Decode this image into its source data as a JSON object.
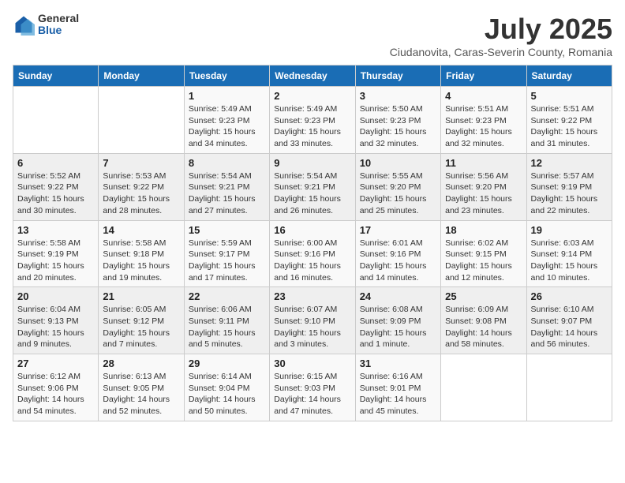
{
  "header": {
    "logo": {
      "general": "General",
      "blue": "Blue"
    },
    "month": "July 2025",
    "location": "Ciudanovita, Caras-Severin County, Romania"
  },
  "weekdays": [
    "Sunday",
    "Monday",
    "Tuesday",
    "Wednesday",
    "Thursday",
    "Friday",
    "Saturday"
  ],
  "weeks": [
    [
      {
        "day": "",
        "sunrise": "",
        "sunset": "",
        "daylight": ""
      },
      {
        "day": "",
        "sunrise": "",
        "sunset": "",
        "daylight": ""
      },
      {
        "day": "1",
        "sunrise": "Sunrise: 5:49 AM",
        "sunset": "Sunset: 9:23 PM",
        "daylight": "Daylight: 15 hours and 34 minutes."
      },
      {
        "day": "2",
        "sunrise": "Sunrise: 5:49 AM",
        "sunset": "Sunset: 9:23 PM",
        "daylight": "Daylight: 15 hours and 33 minutes."
      },
      {
        "day": "3",
        "sunrise": "Sunrise: 5:50 AM",
        "sunset": "Sunset: 9:23 PM",
        "daylight": "Daylight: 15 hours and 32 minutes."
      },
      {
        "day": "4",
        "sunrise": "Sunrise: 5:51 AM",
        "sunset": "Sunset: 9:23 PM",
        "daylight": "Daylight: 15 hours and 32 minutes."
      },
      {
        "day": "5",
        "sunrise": "Sunrise: 5:51 AM",
        "sunset": "Sunset: 9:22 PM",
        "daylight": "Daylight: 15 hours and 31 minutes."
      }
    ],
    [
      {
        "day": "6",
        "sunrise": "Sunrise: 5:52 AM",
        "sunset": "Sunset: 9:22 PM",
        "daylight": "Daylight: 15 hours and 30 minutes."
      },
      {
        "day": "7",
        "sunrise": "Sunrise: 5:53 AM",
        "sunset": "Sunset: 9:22 PM",
        "daylight": "Daylight: 15 hours and 28 minutes."
      },
      {
        "day": "8",
        "sunrise": "Sunrise: 5:54 AM",
        "sunset": "Sunset: 9:21 PM",
        "daylight": "Daylight: 15 hours and 27 minutes."
      },
      {
        "day": "9",
        "sunrise": "Sunrise: 5:54 AM",
        "sunset": "Sunset: 9:21 PM",
        "daylight": "Daylight: 15 hours and 26 minutes."
      },
      {
        "day": "10",
        "sunrise": "Sunrise: 5:55 AM",
        "sunset": "Sunset: 9:20 PM",
        "daylight": "Daylight: 15 hours and 25 minutes."
      },
      {
        "day": "11",
        "sunrise": "Sunrise: 5:56 AM",
        "sunset": "Sunset: 9:20 PM",
        "daylight": "Daylight: 15 hours and 23 minutes."
      },
      {
        "day": "12",
        "sunrise": "Sunrise: 5:57 AM",
        "sunset": "Sunset: 9:19 PM",
        "daylight": "Daylight: 15 hours and 22 minutes."
      }
    ],
    [
      {
        "day": "13",
        "sunrise": "Sunrise: 5:58 AM",
        "sunset": "Sunset: 9:19 PM",
        "daylight": "Daylight: 15 hours and 20 minutes."
      },
      {
        "day": "14",
        "sunrise": "Sunrise: 5:58 AM",
        "sunset": "Sunset: 9:18 PM",
        "daylight": "Daylight: 15 hours and 19 minutes."
      },
      {
        "day": "15",
        "sunrise": "Sunrise: 5:59 AM",
        "sunset": "Sunset: 9:17 PM",
        "daylight": "Daylight: 15 hours and 17 minutes."
      },
      {
        "day": "16",
        "sunrise": "Sunrise: 6:00 AM",
        "sunset": "Sunset: 9:16 PM",
        "daylight": "Daylight: 15 hours and 16 minutes."
      },
      {
        "day": "17",
        "sunrise": "Sunrise: 6:01 AM",
        "sunset": "Sunset: 9:16 PM",
        "daylight": "Daylight: 15 hours and 14 minutes."
      },
      {
        "day": "18",
        "sunrise": "Sunrise: 6:02 AM",
        "sunset": "Sunset: 9:15 PM",
        "daylight": "Daylight: 15 hours and 12 minutes."
      },
      {
        "day": "19",
        "sunrise": "Sunrise: 6:03 AM",
        "sunset": "Sunset: 9:14 PM",
        "daylight": "Daylight: 15 hours and 10 minutes."
      }
    ],
    [
      {
        "day": "20",
        "sunrise": "Sunrise: 6:04 AM",
        "sunset": "Sunset: 9:13 PM",
        "daylight": "Daylight: 15 hours and 9 minutes."
      },
      {
        "day": "21",
        "sunrise": "Sunrise: 6:05 AM",
        "sunset": "Sunset: 9:12 PM",
        "daylight": "Daylight: 15 hours and 7 minutes."
      },
      {
        "day": "22",
        "sunrise": "Sunrise: 6:06 AM",
        "sunset": "Sunset: 9:11 PM",
        "daylight": "Daylight: 15 hours and 5 minutes."
      },
      {
        "day": "23",
        "sunrise": "Sunrise: 6:07 AM",
        "sunset": "Sunset: 9:10 PM",
        "daylight": "Daylight: 15 hours and 3 minutes."
      },
      {
        "day": "24",
        "sunrise": "Sunrise: 6:08 AM",
        "sunset": "Sunset: 9:09 PM",
        "daylight": "Daylight: 15 hours and 1 minute."
      },
      {
        "day": "25",
        "sunrise": "Sunrise: 6:09 AM",
        "sunset": "Sunset: 9:08 PM",
        "daylight": "Daylight: 14 hours and 58 minutes."
      },
      {
        "day": "26",
        "sunrise": "Sunrise: 6:10 AM",
        "sunset": "Sunset: 9:07 PM",
        "daylight": "Daylight: 14 hours and 56 minutes."
      }
    ],
    [
      {
        "day": "27",
        "sunrise": "Sunrise: 6:12 AM",
        "sunset": "Sunset: 9:06 PM",
        "daylight": "Daylight: 14 hours and 54 minutes."
      },
      {
        "day": "28",
        "sunrise": "Sunrise: 6:13 AM",
        "sunset": "Sunset: 9:05 PM",
        "daylight": "Daylight: 14 hours and 52 minutes."
      },
      {
        "day": "29",
        "sunrise": "Sunrise: 6:14 AM",
        "sunset": "Sunset: 9:04 PM",
        "daylight": "Daylight: 14 hours and 50 minutes."
      },
      {
        "day": "30",
        "sunrise": "Sunrise: 6:15 AM",
        "sunset": "Sunset: 9:03 PM",
        "daylight": "Daylight: 14 hours and 47 minutes."
      },
      {
        "day": "31",
        "sunrise": "Sunrise: 6:16 AM",
        "sunset": "Sunset: 9:01 PM",
        "daylight": "Daylight: 14 hours and 45 minutes."
      },
      {
        "day": "",
        "sunrise": "",
        "sunset": "",
        "daylight": ""
      },
      {
        "day": "",
        "sunrise": "",
        "sunset": "",
        "daylight": ""
      }
    ]
  ]
}
